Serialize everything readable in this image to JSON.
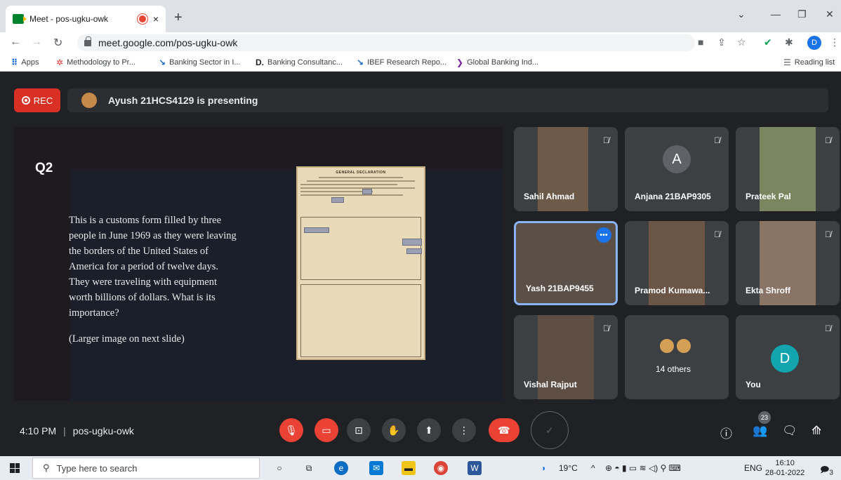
{
  "browser": {
    "tab_title": "Meet - pos-ugku-owk",
    "tab_close": "×",
    "new_tab": "+",
    "url": "meet.google.com/pos-ugku-owk",
    "profile_initial": "D",
    "bookmarks": [
      {
        "label": "Apps",
        "icon": "apps-grid-icon"
      },
      {
        "label": "Methodology to Pr...",
        "icon": "methodology-icon"
      },
      {
        "label": "Banking Sector in I...",
        "icon": "ibef-icon"
      },
      {
        "label": "Banking Consultanc...",
        "icon": "d-icon"
      },
      {
        "label": "IBEF Research Repo...",
        "icon": "ibef-icon"
      },
      {
        "label": "Global Banking Ind...",
        "icon": "chevron-icon"
      }
    ],
    "reading_list": "Reading list"
  },
  "meet": {
    "rec_label": "REC",
    "presenting_text": "Ayush 21HCS4129 is presenting",
    "slide": {
      "heading": "Q2",
      "body": "This is a customs form filled by three\npeople in June 1969 as they were leaving\nthe borders of the United States of\nAmerica for a period of twelve days.\nThey were traveling with equipment\nworth billions of dollars. What is its\nimportance?",
      "note": "(Larger image on next slide)",
      "document_title": "GENERAL DECLARATION"
    },
    "participants": [
      {
        "name": "Sahil Ahmad",
        "muted": true
      },
      {
        "name": "Anjana 21BAP9305",
        "muted": true,
        "initial": "A",
        "color": "#5f6368"
      },
      {
        "name": "Prateek Pal",
        "muted": true
      },
      {
        "name": "Yash 21BAP9455",
        "muted": false,
        "active": true
      },
      {
        "name": "Pramod Kumawa...",
        "muted": true
      },
      {
        "name": "Ekta Shroff",
        "muted": true
      },
      {
        "name": "Vishal Rajput",
        "muted": true
      },
      {
        "name": "14 others",
        "muted": false
      },
      {
        "name": "You",
        "muted": true,
        "initial": "D",
        "color": "#12a4af"
      }
    ],
    "bottom": {
      "time": "4:10 PM",
      "sep": "|",
      "meeting_code": "pos-ugku-owk",
      "people_count": "23"
    }
  },
  "taskbar": {
    "search_placeholder": "Type here to search",
    "temperature": "19°C",
    "language": "ENG",
    "time": "16:10",
    "date": "28-01-2022",
    "notification_count": "3"
  }
}
